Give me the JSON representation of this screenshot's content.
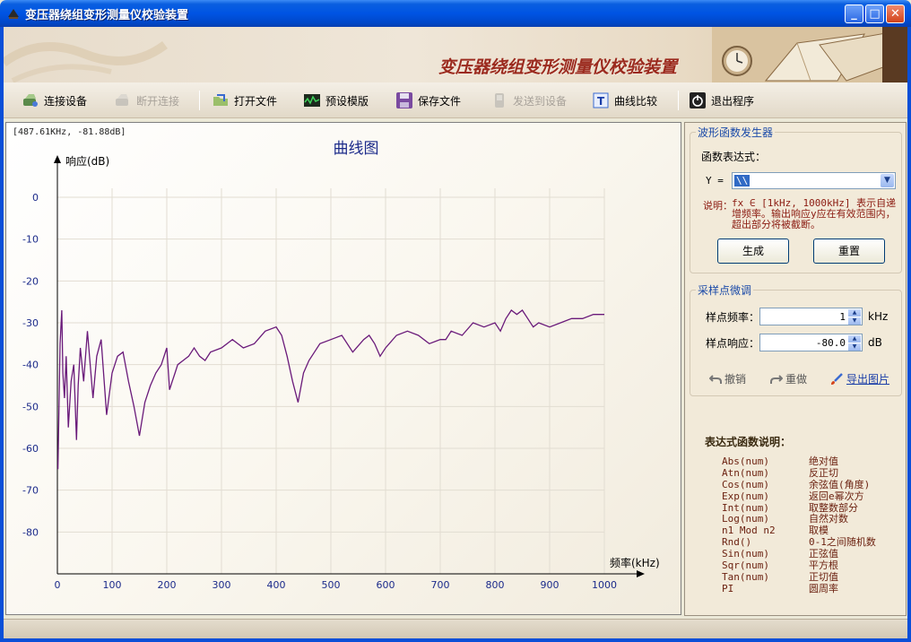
{
  "window": {
    "title": "变压器绕组变形测量仪校验装置"
  },
  "banner": {
    "title": "变压器绕组变形测量仪校验装置"
  },
  "toolbar": {
    "items": [
      {
        "label": "连接设备",
        "icon": "connect-device-icon",
        "enabled": true
      },
      {
        "label": "断开连接",
        "icon": "disconnect-icon",
        "enabled": false
      },
      {
        "label": "打开文件",
        "icon": "open-file-icon",
        "enabled": true
      },
      {
        "label": "预设模版",
        "icon": "template-icon",
        "enabled": true
      },
      {
        "label": "保存文件",
        "icon": "save-icon",
        "enabled": true
      },
      {
        "label": "发送到设备",
        "icon": "send-to-device-icon",
        "enabled": false
      },
      {
        "label": "曲线比较",
        "icon": "compare-curve-icon",
        "enabled": true
      },
      {
        "label": "退出程序",
        "icon": "exit-icon",
        "enabled": true
      }
    ]
  },
  "chart_readout": "[487.61KHz, -81.88dB]",
  "chart_data": {
    "type": "line",
    "title": "曲线图",
    "xlabel": "频率(kHz)",
    "ylabel": "响应(dB)",
    "xlim": [
      0,
      1000
    ],
    "ylim": [
      -90,
      0
    ],
    "x_ticks": [
      0,
      100,
      200,
      300,
      400,
      500,
      600,
      700,
      800,
      900,
      1000
    ],
    "y_ticks": [
      0,
      -10,
      -20,
      -30,
      -40,
      -50,
      -60,
      -70,
      -80
    ],
    "grid": true,
    "line_color": "#6a1a7a",
    "series": [
      {
        "x": [
          1,
          3,
          5,
          8,
          10,
          13,
          16,
          20,
          25,
          30,
          35,
          38,
          42,
          48,
          55,
          60,
          65,
          72,
          80,
          90,
          100,
          110,
          120,
          130,
          140,
          150,
          160,
          170,
          180,
          190,
          200,
          205,
          210,
          215,
          220,
          230,
          240,
          250,
          260,
          270,
          280,
          300,
          320,
          340,
          360,
          380,
          400,
          410,
          420,
          430,
          440,
          450,
          460,
          470,
          480,
          500,
          520,
          540,
          560,
          570,
          580,
          590,
          600,
          620,
          640,
          660,
          680,
          700,
          710,
          720,
          740,
          760,
          780,
          800,
          810,
          820,
          830,
          840,
          850,
          860,
          870,
          880,
          900,
          920,
          940,
          960,
          980,
          1000
        ],
        "y": [
          -65,
          -50,
          -35,
          -27,
          -42,
          -48,
          -38,
          -55,
          -44,
          -40,
          -58,
          -45,
          -36,
          -44,
          -32,
          -40,
          -48,
          -38,
          -34,
          -52,
          -42,
          -38,
          -37,
          -44,
          -50,
          -57,
          -49,
          -45,
          -42,
          -40,
          -36,
          -46,
          -44,
          -42,
          -40,
          -39,
          -38,
          -36,
          -38,
          -39,
          -37,
          -36,
          -34,
          -36,
          -35,
          -32,
          -31,
          -33,
          -38,
          -44,
          -49,
          -42,
          -39,
          -37,
          -35,
          -34,
          -33,
          -37,
          -34,
          -33,
          -35,
          -38,
          -36,
          -33,
          -32,
          -33,
          -35,
          -34,
          -34,
          -32,
          -33,
          -30,
          -31,
          -30,
          -32,
          -29,
          -27,
          -28,
          -27,
          -29,
          -31,
          -30,
          -31,
          -30,
          -29,
          -29,
          -28,
          -28
        ]
      }
    ]
  },
  "wave_generator": {
    "title": "波形函数发生器",
    "expr_label": "函数表达式：",
    "y_label": "Y =",
    "expr_value": "\\\\",
    "note_label": "说明：",
    "note_text": "fx ∈ [1kHz, 1000kHz] 表示自递增频率。输出响应y应在有效范围内，超出部分将被截断。",
    "generate_button": "生成",
    "reset_button": "重置"
  },
  "sample_adjust": {
    "title": "采样点微调",
    "freq_label": "样点频率：",
    "freq_value": "1",
    "freq_unit": "kHz",
    "resp_label": "样点响应：",
    "resp_value": "-80.0",
    "resp_unit": "dB",
    "undo_label": "撤销",
    "redo_label": "重做",
    "export_label": "导出图片"
  },
  "help": {
    "title": "表达式函数说明：",
    "rows": [
      {
        "fn": "Abs(num)",
        "desc": "绝对值"
      },
      {
        "fn": "Atn(num)",
        "desc": "反正切"
      },
      {
        "fn": "Cos(num)",
        "desc": "余弦值(角度)"
      },
      {
        "fn": "Exp(num)",
        "desc": "返回e幂次方"
      },
      {
        "fn": "Int(num)",
        "desc": "取整数部分"
      },
      {
        "fn": "Log(num)",
        "desc": "自然对数"
      },
      {
        "fn": "n1 Mod n2",
        "desc": "取模"
      },
      {
        "fn": "Rnd()",
        "desc": "0-1之间随机数"
      },
      {
        "fn": "Sin(num)",
        "desc": "正弦值"
      },
      {
        "fn": "Sqr(num)",
        "desc": "平方根"
      },
      {
        "fn": "Tan(num)",
        "desc": "正切值"
      },
      {
        "fn": "PI",
        "desc": "圆周率"
      }
    ]
  }
}
